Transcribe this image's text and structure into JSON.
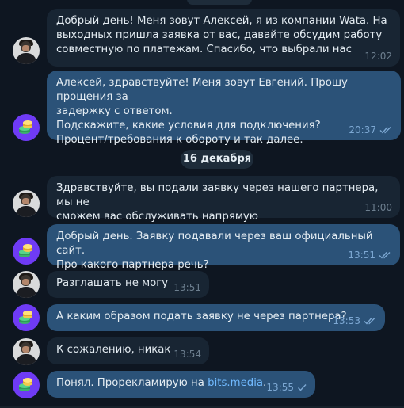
{
  "date_separator": "16 декабря",
  "messages": [
    {
      "id": 1,
      "direction": "in",
      "avatar": "user-avatar-photo",
      "text": "Добрый день! Меня зовут Алексей, я из компании Wata. На\nвыходных пришла заявка от вас, давайте обсудим работу\nсовместную по платежам. Спасибо, что выбрали нас",
      "time": "12:02"
    },
    {
      "id": 2,
      "direction": "out",
      "avatar": "company-logo-avatar",
      "text": "Алексей, здравствуйте! Меня зовут Евгений. Прошу прощения за\nзадержку с ответом.\nПодскажите, какие условия для подключения?\nПроцент/требования к обороту и так далее.",
      "time": "20:37",
      "status": "read"
    },
    {
      "id": 3,
      "direction": "in",
      "avatar": "user-avatar-photo",
      "text": "Здравствуйте, вы подали заявку через нашего партнера, мы не\nсможем вас обслуживать напрямую",
      "time": "11:00"
    },
    {
      "id": 4,
      "direction": "out",
      "avatar": "company-logo-avatar",
      "text": "Добрый день. Заявку подавали через ваш официальный сайт.\nПро какого партнера речь?",
      "time": "13:51",
      "status": "read"
    },
    {
      "id": 5,
      "direction": "in",
      "avatar": "user-avatar-photo",
      "text": "Разглашать не могу",
      "time": "13:51"
    },
    {
      "id": 6,
      "direction": "out",
      "avatar": "company-logo-avatar",
      "text": "А каким образом подать заявку не через партнера?",
      "time": "13:53",
      "status": "read"
    },
    {
      "id": 7,
      "direction": "in",
      "avatar": "user-avatar-photo",
      "text": "К сожалению, никак",
      "time": "13:54"
    },
    {
      "id": 8,
      "direction": "out",
      "avatar": "company-logo-avatar",
      "text_prefix": "Понял. Прорекламирую на ",
      "link": "bits.media",
      "text_suffix": ".",
      "time": "13:55",
      "status": "sent"
    }
  ],
  "colors": {
    "background": "#0e1621",
    "incoming_bubble": "#182533",
    "outgoing_bubble": "#2b5278",
    "link": "#71baff",
    "company_avatar": "#6f3bf5"
  }
}
